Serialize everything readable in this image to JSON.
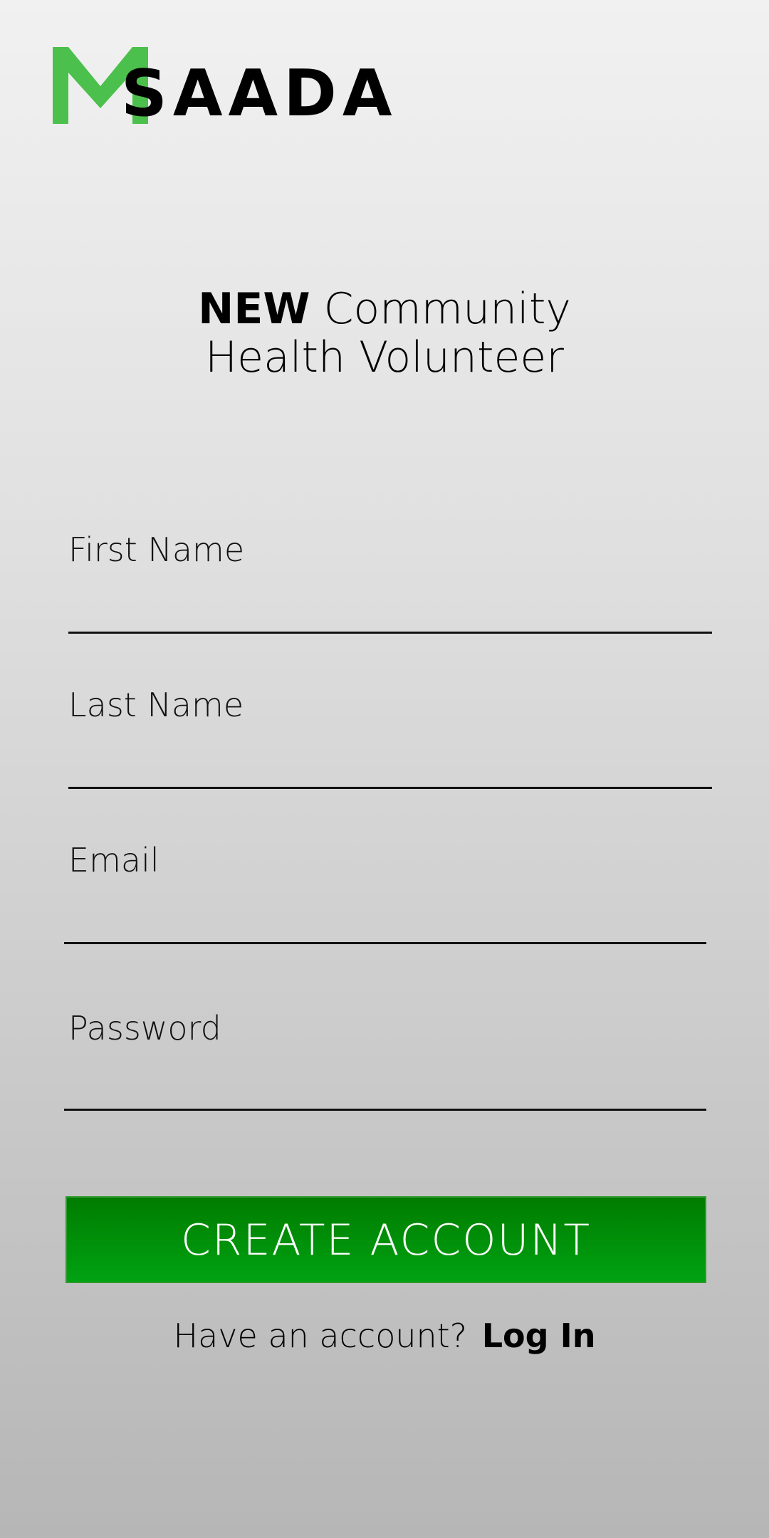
{
  "brand": {
    "logo_mark": "M",
    "logo_text": "SAADA",
    "accent_color": "#4cc04c",
    "logo_text_color": "#000000"
  },
  "heading": {
    "bold": "NEW",
    "line1_rest": "Community",
    "line2": "Health Volunteer"
  },
  "form": {
    "first_name": {
      "label": "First Name",
      "value": ""
    },
    "last_name": {
      "label": "Last Name",
      "value": ""
    },
    "email": {
      "label": "Email",
      "value": ""
    },
    "password": {
      "label": "Password",
      "value": ""
    }
  },
  "create_button": {
    "label": "CREATE ACCOUNT",
    "color": "#009a0a"
  },
  "login_prompt": {
    "text": "Have an account?",
    "link": "Log In"
  }
}
